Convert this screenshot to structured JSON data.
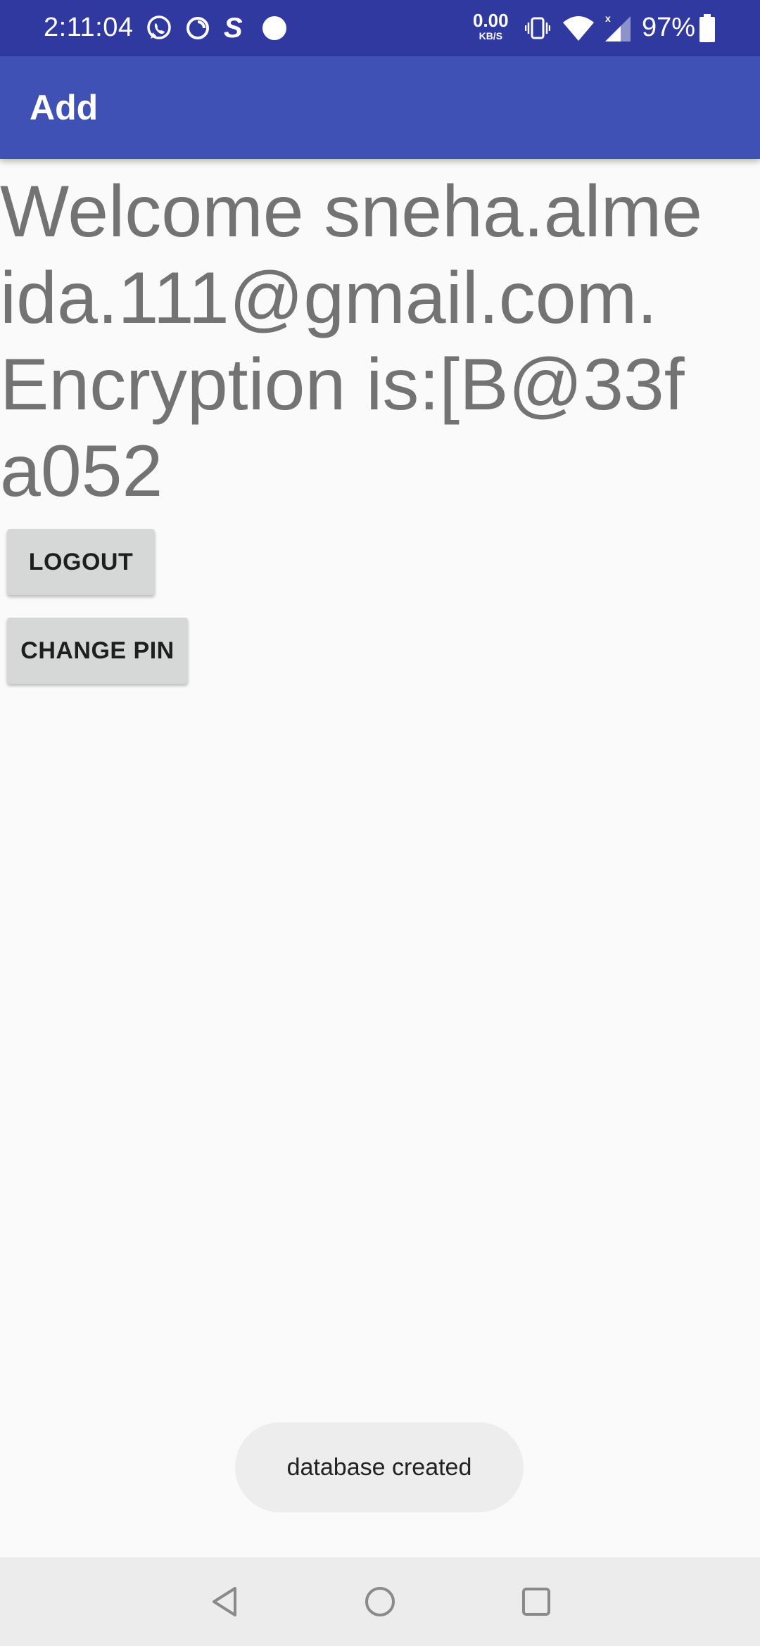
{
  "status_bar": {
    "time": "2:11:04",
    "net_speed_value": "0.00",
    "net_speed_unit": "KB/S",
    "battery_percent": "97%",
    "icons": [
      "whatsapp-icon",
      "sync-icon",
      "s-app-icon",
      "dot-icon",
      "vibrate-icon",
      "wifi-icon",
      "signal-icon",
      "battery-icon"
    ]
  },
  "app_bar": {
    "title": "Add"
  },
  "main": {
    "welcome_text": "Welcome sneha.almeida.111@gmail.com. Encryption is:[B@33fa052",
    "logout_label": "LOGOUT",
    "change_pin_label": "CHANGE PIN"
  },
  "toast": {
    "message": "database created"
  },
  "nav_bar": {
    "icons": [
      "back-icon",
      "home-icon",
      "recents-icon"
    ]
  },
  "colors": {
    "status_bar": "#3039a0",
    "app_bar": "#3f51b5",
    "background": "#fafafa",
    "button": "#d6d7d7"
  }
}
